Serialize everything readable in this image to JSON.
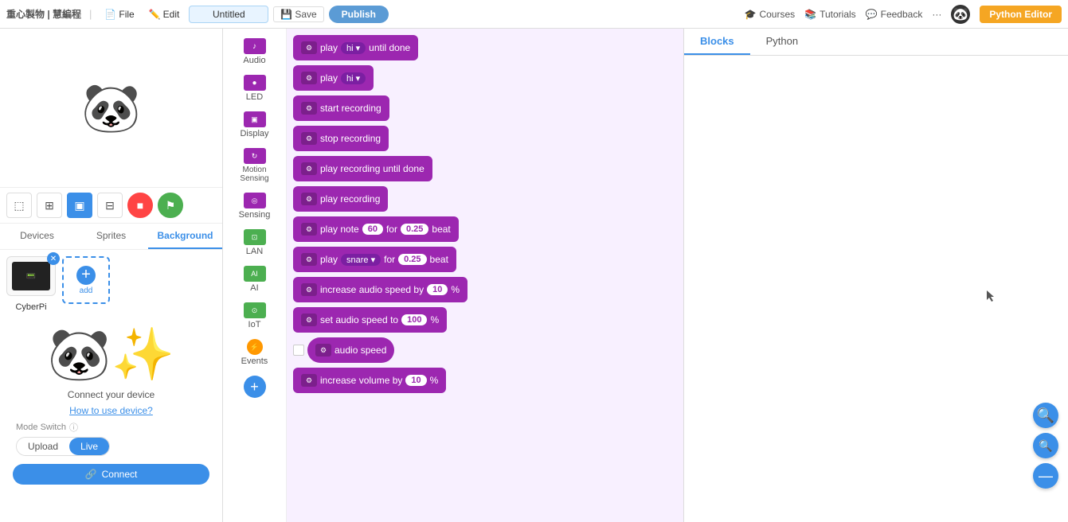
{
  "topbar": {
    "brand": "重心製物 | 慧編程",
    "file_label": "File",
    "edit_label": "Edit",
    "project_name": "Untitled",
    "save_label": "Save",
    "publish_label": "Publish",
    "courses_label": "Courses",
    "tutorials_label": "Tutorials",
    "feedback_label": "Feedback",
    "more_label": "···",
    "python_editor_label": "Python Editor"
  },
  "workspace_tabs": {
    "blocks_label": "Blocks",
    "python_label": "Python"
  },
  "panel_tabs": {
    "devices_label": "Devices",
    "sprites_label": "Sprites",
    "background_label": "Background"
  },
  "mode_switch": {
    "label": "Mode Switch",
    "upload_label": "Upload",
    "live_label": "Live",
    "connect_label": "Connect"
  },
  "categories": [
    {
      "id": "audio",
      "label": "Audio",
      "color": "purple"
    },
    {
      "id": "led",
      "label": "LED",
      "color": "purple"
    },
    {
      "id": "display",
      "label": "Display",
      "color": "purple"
    },
    {
      "id": "motion",
      "label": "Motion Sensing",
      "color": "purple"
    },
    {
      "id": "sensing",
      "label": "Sensing",
      "color": "purple"
    },
    {
      "id": "lan",
      "label": "LAN",
      "color": "green"
    },
    {
      "id": "ai",
      "label": "AI",
      "color": "green"
    },
    {
      "id": "iot",
      "label": "IoT",
      "color": "green"
    },
    {
      "id": "events",
      "label": "Events",
      "color": "yellow"
    },
    {
      "id": "add",
      "label": "",
      "color": "blue"
    }
  ],
  "blocks": [
    {
      "id": "play_hi_until",
      "type": "play_dropdown_until",
      "text1": "play",
      "dropdown": "hi ▾",
      "text2": "until done"
    },
    {
      "id": "play_hi",
      "type": "play_dropdown",
      "text1": "play",
      "dropdown": "hi ▾"
    },
    {
      "id": "start_recording",
      "type": "simple",
      "text": "start recording"
    },
    {
      "id": "stop_recording",
      "type": "simple",
      "text": "stop recording"
    },
    {
      "id": "play_recording_until",
      "type": "simple",
      "text": "play recording until done"
    },
    {
      "id": "play_recording",
      "type": "simple",
      "text": "play recording"
    },
    {
      "id": "play_note",
      "type": "play_note",
      "text1": "play note",
      "note": "60",
      "text2": "for",
      "beat": "0.25",
      "text3": "beat"
    },
    {
      "id": "play_snare",
      "type": "play_snare",
      "text1": "play",
      "dropdown": "snare ▾",
      "text2": "for",
      "beat": "0.25",
      "text3": "beat"
    },
    {
      "id": "increase_audio_speed",
      "type": "with_value",
      "text1": "increase audio speed by",
      "value": "10",
      "unit": "%"
    },
    {
      "id": "set_audio_speed",
      "type": "with_value",
      "text1": "set audio speed to",
      "value": "100",
      "unit": "%"
    },
    {
      "id": "audio_speed",
      "type": "reporter",
      "text": "audio speed",
      "has_checkbox": true
    },
    {
      "id": "increase_volume",
      "type": "with_value",
      "text1": "increase volume by",
      "value": "10",
      "unit": "%"
    }
  ],
  "device": {
    "name": "CyberPi",
    "connect_text": "Connect your device",
    "help_link": "How to use device?"
  },
  "icons": {
    "file": "📄",
    "edit": "✏️",
    "globe": "🌐",
    "save": "💾",
    "close": "✕",
    "plus": "+",
    "link": "🔗",
    "zoom_in": "🔍",
    "zoom_out": "🔍",
    "zoom_reset": "⊙"
  }
}
